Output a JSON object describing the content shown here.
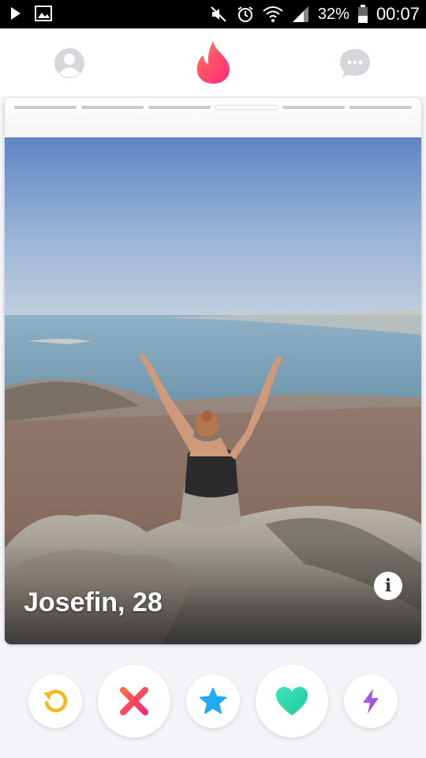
{
  "status_bar": {
    "battery": "32%",
    "time": "00:07",
    "icons": [
      "play-icon",
      "image-icon",
      "mute-icon",
      "alarm-icon",
      "wifi-icon",
      "signal-icon",
      "battery-icon"
    ]
  },
  "nav": {
    "icons": [
      "profile-icon",
      "flame-icon",
      "chat-icon"
    ],
    "active": "flame-icon"
  },
  "card": {
    "photo_count": 6,
    "active_photo_index": 3,
    "name_age": "Josefin, 28",
    "info_label": "i"
  },
  "actions": [
    {
      "name": "rewind",
      "icon": "rewind-icon",
      "color": "#f5b71c"
    },
    {
      "name": "nope",
      "icon": "close-icon",
      "color": "#fd5068"
    },
    {
      "name": "super-like",
      "icon": "star-icon",
      "color": "#23a8f2"
    },
    {
      "name": "like",
      "icon": "heart-icon",
      "color": "#28d9a8"
    },
    {
      "name": "boost",
      "icon": "bolt-icon",
      "color": "#a657e5"
    }
  ],
  "colors": {
    "brand": "#fd5068",
    "nav_inactive": "#d6d7dc"
  }
}
